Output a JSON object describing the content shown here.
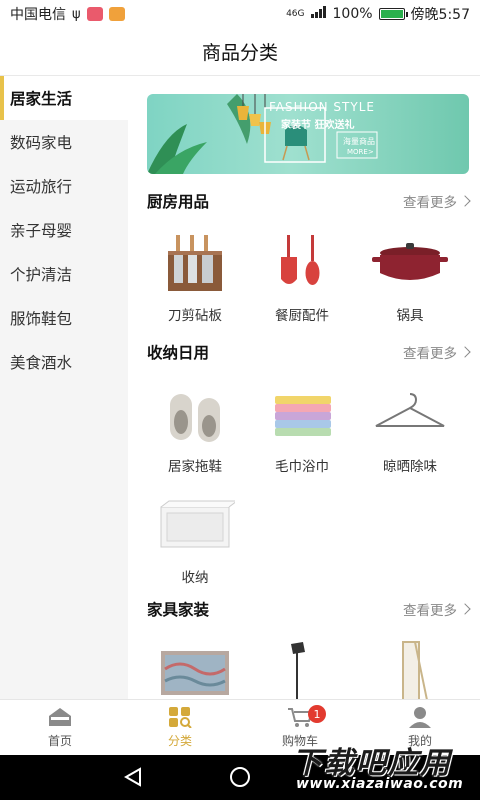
{
  "status_bar": {
    "carrier": "中国电信",
    "signal": "46G",
    "battery": "100%",
    "time": "傍晚5:57"
  },
  "header": {
    "title": "商品分类"
  },
  "sidebar": {
    "items": [
      {
        "label": "居家生活",
        "active": true
      },
      {
        "label": "数码家电",
        "active": false
      },
      {
        "label": "运动旅行",
        "active": false
      },
      {
        "label": "亲子母婴",
        "active": false
      },
      {
        "label": "个护清洁",
        "active": false
      },
      {
        "label": "服饰鞋包",
        "active": false
      },
      {
        "label": "美食酒水",
        "active": false
      }
    ]
  },
  "banner": {
    "title": "FASHION STYLE",
    "subtitle": "家装节 狂欢送礼",
    "button": "海量商品",
    "more": "MORE>"
  },
  "sections": [
    {
      "title": "厨房用品",
      "more": "查看更多",
      "items": [
        {
          "label": "刀剪砧板",
          "icon": "knife-set-icon"
        },
        {
          "label": "餐厨配件",
          "icon": "spatula-icon"
        },
        {
          "label": "锅具",
          "icon": "pot-icon"
        }
      ]
    },
    {
      "title": "收纳日用",
      "more": "查看更多",
      "items": [
        {
          "label": "居家拖鞋",
          "icon": "slippers-icon"
        },
        {
          "label": "毛巾浴巾",
          "icon": "towels-icon"
        },
        {
          "label": "晾晒除味",
          "icon": "hanger-icon"
        },
        {
          "label": "收纳",
          "icon": "storage-box-icon"
        }
      ]
    },
    {
      "title": "家具家装",
      "more": "查看更多",
      "items": [
        {
          "label": "",
          "icon": "rug-icon"
        },
        {
          "label": "",
          "icon": "lamp-icon"
        },
        {
          "label": "",
          "icon": "mirror-icon"
        }
      ]
    }
  ],
  "tabbar": {
    "tabs": [
      {
        "label": "首页",
        "icon": "home-icon",
        "active": false
      },
      {
        "label": "分类",
        "icon": "category-icon",
        "active": true
      },
      {
        "label": "购物车",
        "icon": "cart-icon",
        "active": false,
        "badge": "1"
      },
      {
        "label": "我的",
        "icon": "user-icon",
        "active": false
      }
    ]
  },
  "watermark": {
    "line1": "下载吧应用",
    "line2": "www.xiazaiwao.com"
  },
  "colors": {
    "accent": "#d4a93a",
    "badge": "#e23a2f",
    "sidebar_bg": "#f5f5f5"
  }
}
